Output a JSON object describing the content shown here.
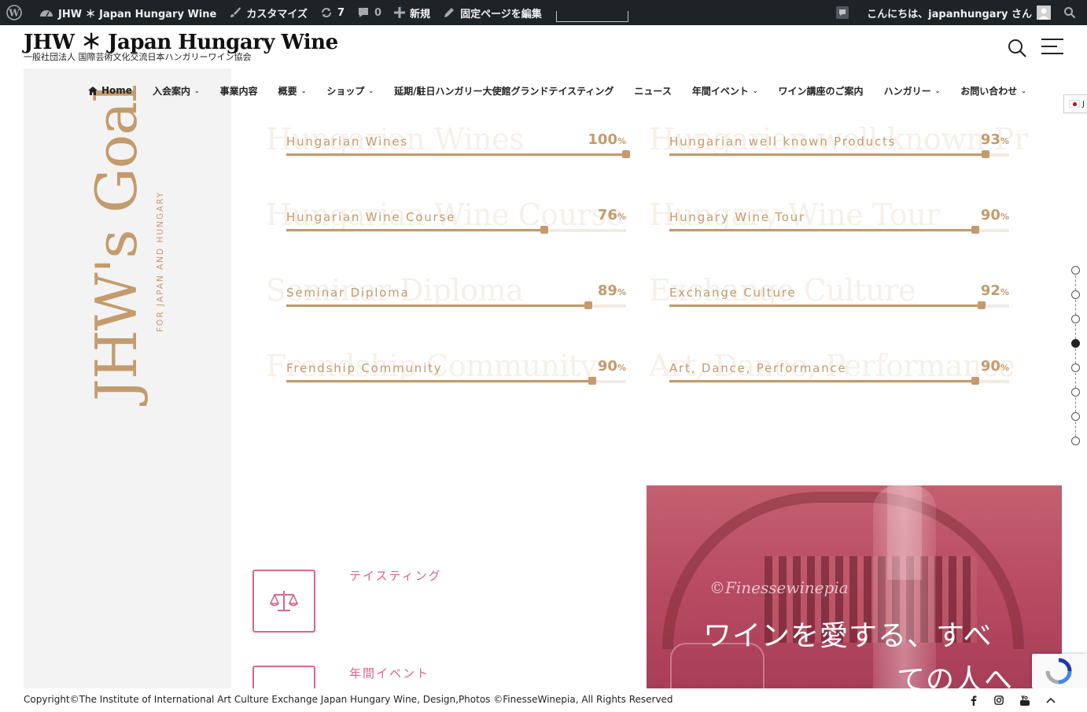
{
  "adminbar": {
    "site_name": "JHW ＊ Japan Hungary Wine",
    "customize": "カスタマイズ",
    "updates_count": "7",
    "comments_count": "0",
    "new_label": "新規",
    "edit_page": "固定ページを編集",
    "greeting": "こんにちは、japanhungary さん"
  },
  "header": {
    "title": "JHW ＊ Japan Hungary Wine",
    "description": "一般社団法人 国際芸術文化交流日本ハンガリーワイン協会"
  },
  "nav": {
    "items": [
      {
        "label": "Home"
      },
      {
        "label": "入会案内"
      },
      {
        "label": "事業内容"
      },
      {
        "label": "概要"
      },
      {
        "label": "ショップ"
      },
      {
        "label": "延期/駐日ハンガリー大使館グランドテイスティング"
      },
      {
        "label": "ニュース"
      },
      {
        "label": "年間イベント"
      },
      {
        "label": "ワイン講座のご案内"
      },
      {
        "label": "ハンガリー"
      },
      {
        "label": "お問い合わせ"
      }
    ],
    "lang": "J"
  },
  "sidebar": {
    "title": "JHW's Goal",
    "subtitle": "FOR JAPAN AND HUNGARY"
  },
  "skills": [
    {
      "label": "Hungarian Wines",
      "bg": "Hungarian Wines",
      "value": "100",
      "percent": 100
    },
    {
      "label": "Hungarian well known Products",
      "bg": "Hungarian well known Pr",
      "value": "93",
      "percent": 93
    },
    {
      "label": "Hungarian Wine Course",
      "bg": "Hungarian Wine Course",
      "value": "76",
      "percent": 76
    },
    {
      "label": "Hungary Wine Tour",
      "bg": "Hungary Wine Tour",
      "value": "90",
      "percent": 90
    },
    {
      "label": "Seminar Diploma",
      "bg": "Seminar Diploma",
      "value": "89",
      "percent": 89
    },
    {
      "label": "Exchange Culture",
      "bg": "Exchange Culture",
      "value": "92",
      "percent": 92
    },
    {
      "label": "Frendship Community",
      "bg": "Frendship Community",
      "value": "90",
      "percent": 90
    },
    {
      "label": "Art, Dance, Performance",
      "bg": "Art, Dance, Performance",
      "value": "90",
      "percent": 90
    }
  ],
  "percent_sign": "%",
  "features": [
    {
      "title": "テイスティング"
    },
    {
      "title": "年間イベント"
    }
  ],
  "photo": {
    "watermark": "©Finessewinepia",
    "line1": "ワインを愛する、すべ",
    "line2": "ての人へ"
  },
  "footer": {
    "copyright": "Copyright©The Institute of International Art Culture Exchange Japan Hungary Wine, Design,Photos ©FinesseWinepia, All Rights Reserved"
  },
  "colors": {
    "accent": "#c49b6c",
    "pink": "#d9658f",
    "adminbar": "#1d2327"
  }
}
